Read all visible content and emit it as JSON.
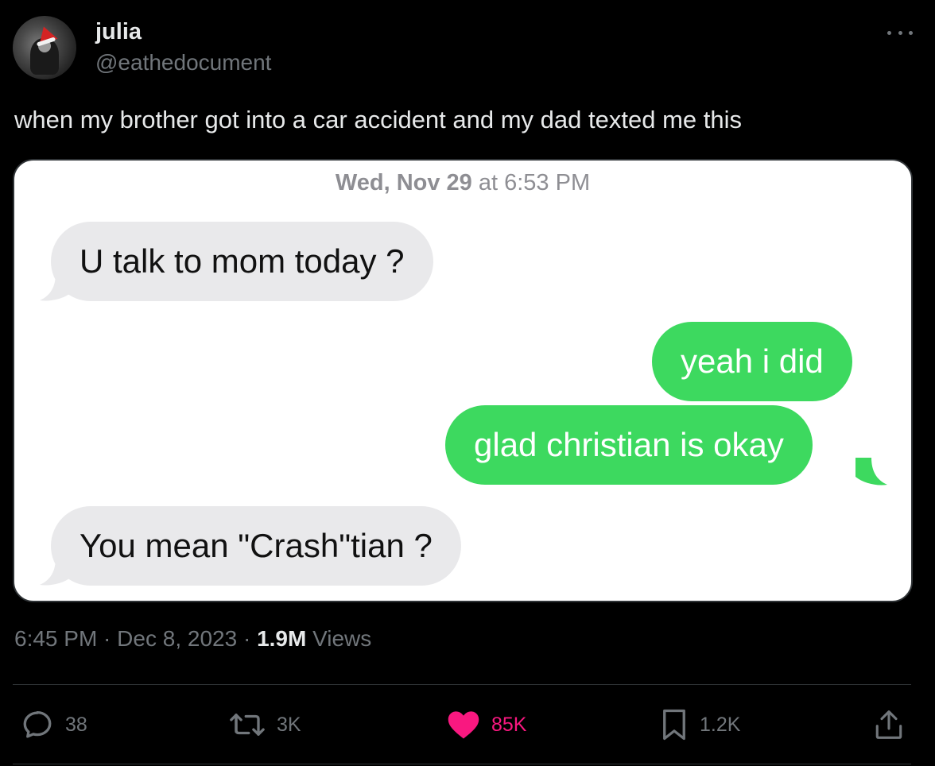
{
  "tweet": {
    "author": {
      "display_name": "julia",
      "handle": "@eathedocument",
      "avatar_icon": "avatar-santa-hat"
    },
    "text": "when my brother got into a car accident and my dad texted me this",
    "media": {
      "timestamp_day": "Wed, Nov 29",
      "timestamp_time": " at 6:53 PM",
      "messages": [
        {
          "direction": "incoming",
          "text": "U talk to mom today ?"
        },
        {
          "direction": "outgoing",
          "text": "yeah i did"
        },
        {
          "direction": "outgoing",
          "text": "glad christian is okay"
        },
        {
          "direction": "incoming",
          "text": "You mean \"Crash\"tian ?"
        }
      ],
      "colors": {
        "incoming_bubble": "#e9e9eb",
        "outgoing_bubble": "#3dd95f"
      }
    },
    "meta": {
      "time": "6:45 PM",
      "separator": " · ",
      "date": "Dec 8, 2023",
      "views_count": "1.9M",
      "views_label": " Views"
    },
    "actions": {
      "replies": {
        "icon": "reply-icon",
        "count": "38"
      },
      "reposts": {
        "icon": "repost-icon",
        "count": "3K"
      },
      "likes": {
        "icon": "heart-icon",
        "count": "85K",
        "liked": true,
        "color": "#f91880"
      },
      "bookmarks": {
        "icon": "bookmark-icon",
        "count": "1.2K"
      },
      "share": {
        "icon": "share-icon"
      }
    }
  }
}
